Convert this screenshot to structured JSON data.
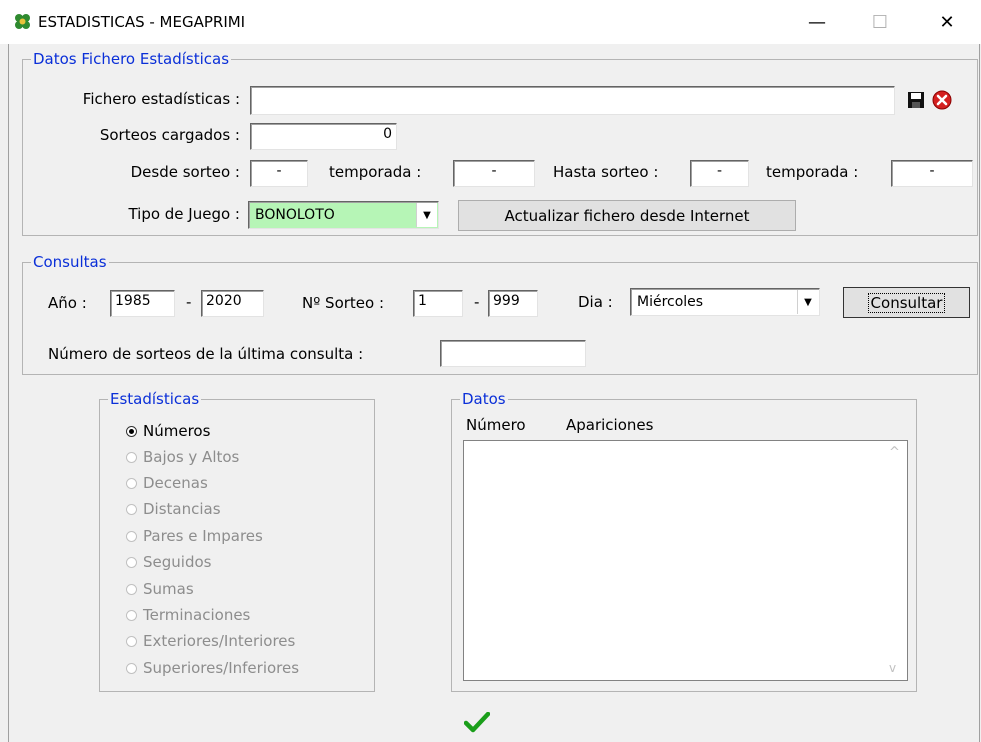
{
  "window": {
    "title": "ESTADISTICAS - MEGAPRIMI",
    "min": "—",
    "max": "☐",
    "close": "✕"
  },
  "fichero": {
    "legend": "Datos Fichero Estadísticas",
    "fichero_label": "Fichero estadísticas :",
    "fichero_value": "",
    "sorteos_label": "Sorteos cargados :",
    "sorteos_value": "0",
    "desde_label": "Desde sorteo :",
    "desde_value": "-",
    "temporada1_label": "temporada :",
    "temporada1_value": "-",
    "hasta_label": "Hasta sorteo :",
    "hasta_value": "-",
    "temporada2_label": "temporada :",
    "temporada2_value": "-",
    "tipo_label": "Tipo de Juego :",
    "tipo_value": "BONOLOTO",
    "actualizar_label": "Actualizar fichero desde Internet"
  },
  "consultas": {
    "legend": "Consultas",
    "anio_label": "Año :",
    "anio_from": "1985",
    "dash1": "-",
    "anio_to": "2020",
    "sorteo_label": "Nº Sorteo :",
    "sorteo_from": "1",
    "dash2": "-",
    "sorteo_to": "999",
    "dia_label": "Dia :",
    "dia_value": "Miércoles",
    "consultar_label": "Consultar",
    "numero_label": "Número de sorteos de la última consulta :",
    "numero_value": ""
  },
  "estadisticas": {
    "legend": "Estadísticas",
    "options": [
      {
        "label": "Números",
        "selected": true,
        "enabled": true
      },
      {
        "label": "Bajos y Altos",
        "enabled": false
      },
      {
        "label": "Decenas",
        "enabled": false
      },
      {
        "label": "Distancias",
        "enabled": false
      },
      {
        "label": "Pares e Impares",
        "enabled": false
      },
      {
        "label": "Seguidos",
        "enabled": false
      },
      {
        "label": "Sumas",
        "enabled": false
      },
      {
        "label": "Terminaciones",
        "enabled": false
      },
      {
        "label": "Exteriores/Interiores",
        "enabled": false
      },
      {
        "label": "Superiores/Inferiores",
        "enabled": false
      }
    ]
  },
  "datos": {
    "legend": "Datos",
    "col1": "Número",
    "col2": "Apariciones",
    "up_arrow": "^",
    "down_arrow": "v"
  },
  "icons": {
    "save": "floppy-disk-icon",
    "delete": "red-x-circle-icon",
    "ok": "green-check-icon",
    "app": "clover-icon"
  },
  "colors": {
    "legend": "#0a2fd8",
    "combo_highlight": "#b6f5b6",
    "accent_green": "#1a9e1a"
  }
}
